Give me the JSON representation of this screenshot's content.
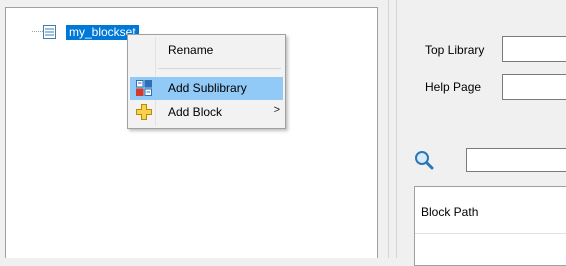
{
  "tree": {
    "root_label": "my_blockset"
  },
  "context_menu": {
    "items": [
      {
        "label": "Rename",
        "icon": "none"
      },
      {
        "label": "Add Sublibrary",
        "icon": "sublibrary-icon"
      },
      {
        "label": "Add Block",
        "icon": "add-block-icon",
        "submenu_arrow": ">"
      }
    ],
    "highlighted_item": "Add Sublibrary",
    "highlight_color": "#91c9f7"
  },
  "form": {
    "top_library_label": "Top Library",
    "top_library_value": "",
    "help_page_label": "Help Page",
    "help_page_value": "",
    "search_value": ""
  },
  "table": {
    "columns": [
      "Block Path"
    ],
    "rows": []
  },
  "colors": {
    "selection": "#0078d7",
    "panel_background": "#f0f0f0"
  }
}
